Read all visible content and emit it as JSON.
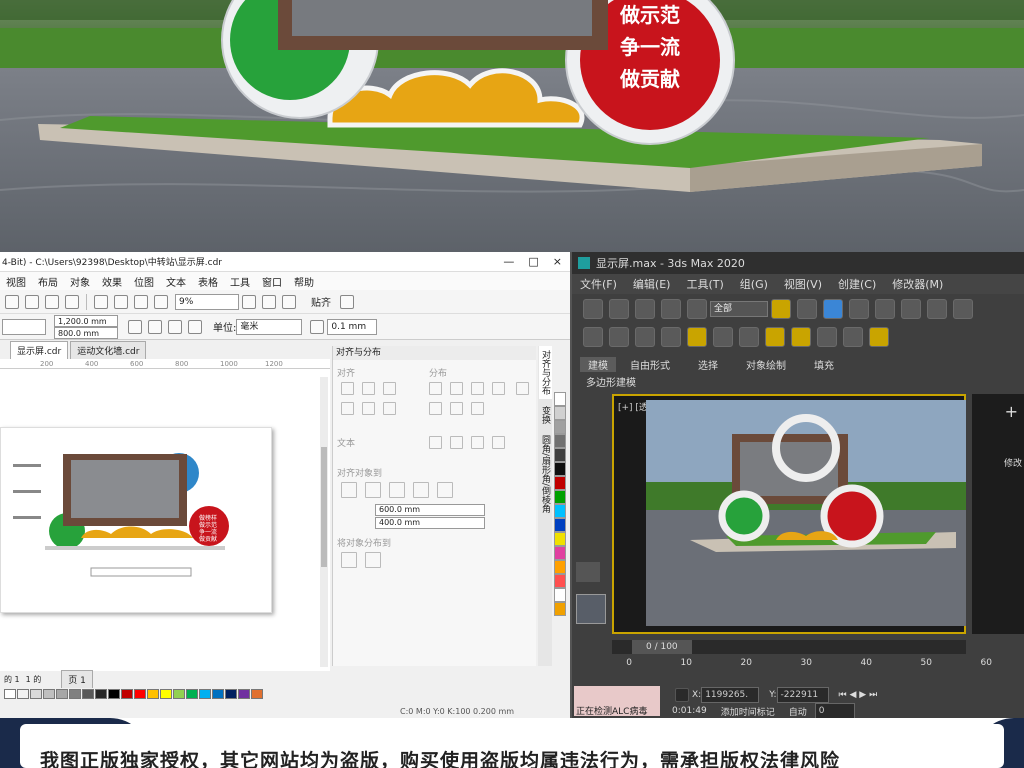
{
  "cdr": {
    "title": "4-Bit) - C:\\Users\\92398\\Desktop\\中转站\\显示屏.cdr",
    "window_controls": [
      "—",
      "□",
      "×"
    ],
    "menu": [
      "视图",
      "布局",
      "对象",
      "效果",
      "位图",
      "文本",
      "表格",
      "工具",
      "窗口",
      "帮助"
    ],
    "zoom": "9%",
    "paste_label": "贴齐",
    "width_value": "1,200.0 mm",
    "height_value": "800.0 mm",
    "unit_label": "单位:",
    "unit_value": "毫米",
    "nudge_value": "0.1 mm",
    "tabs": [
      "显示屏.cdr",
      "运动文化墙.cdr"
    ],
    "ruler_ticks": [
      "200",
      "400",
      "600",
      "800",
      "1000",
      "1200"
    ],
    "page_nav": [
      "的 1",
      "1 的",
      "页 1"
    ],
    "status": "C:0 M:0 Y:0 K:100  0.200 mm",
    "docker": {
      "title": "对齐与分布",
      "section_align": "对齐",
      "section_distribute": "分布",
      "section_text": "文本",
      "section_align_objects": "对齐对象到",
      "x_value": "600.0 mm",
      "y_value": "400.0 mm",
      "section_spacing": "将对象分布到",
      "side_tabs": [
        "对齐与分布",
        "变换",
        "圆角/扇形角/倒棱角"
      ]
    },
    "sign_text": [
      "做榜样",
      "做示范",
      "争一流",
      "做贡献"
    ],
    "palette": [
      "#ffffff",
      "#f2f2f2",
      "#d9d9d9",
      "#bfbfbf",
      "#a6a6a6",
      "#808080",
      "#595959",
      "#262626",
      "#000000",
      "#c00000",
      "#ff0000",
      "#ffc000",
      "#ffff00",
      "#92d050",
      "#00b050",
      "#00b0f0",
      "#0070c0",
      "#002060",
      "#7030a0",
      "#e07030"
    ],
    "side_palette": [
      "#ffffff",
      "#d0d0d0",
      "#a0a0a0",
      "#707070",
      "#404040",
      "#101010",
      "#c00000",
      "#00a000",
      "#00c0ff",
      "#0040c0",
      "#f0e000",
      "#e040a0",
      "#ffa000",
      "#ff5050",
      "#ffffff",
      "#f0a000"
    ]
  },
  "max": {
    "title": "显示屏.max - 3ds Max 2020",
    "menu": [
      "文件(F)",
      "编辑(E)",
      "工具(T)",
      "组(G)",
      "视图(V)",
      "创建(C)",
      "修改器(M)"
    ],
    "selection_filter": "全部",
    "ribbon_tabs": [
      "建模",
      "自由形式",
      "选择",
      "对象绘制",
      "填充"
    ],
    "ribbon_sub": "多边形建模",
    "viewport_label": "[+] [透视] [标准] [默认明暗处理]",
    "timeline": "0 / 100",
    "ticks": [
      "0",
      "10",
      "20",
      "30",
      "40",
      "50",
      "60"
    ],
    "status_left": "正在检测ALC病毒",
    "coord_x_label": "X:",
    "coord_x": "1199265.",
    "coord_y_label": "Y:",
    "coord_y": "-222911",
    "time_label": "添加时间标记",
    "time_value": "0:01:49",
    "auto_label": "自动",
    "frame": "0",
    "right_panel": [
      "+",
      "修改"
    ]
  },
  "render": {
    "sign_text": [
      "做示范",
      "争一流",
      "做贡献"
    ]
  },
  "banner": {
    "text": "我图正版独家授权，其它网站均为盗版，购买使用盗版均属违法行为，需承担版权法律风险"
  },
  "colors": {
    "red": "#c8141c",
    "green": "#27a23b",
    "blue": "#2f87c9",
    "gold": "#e7a514",
    "frame_brown": "#6b4a3a",
    "max_bg": "#3f3f3f"
  }
}
